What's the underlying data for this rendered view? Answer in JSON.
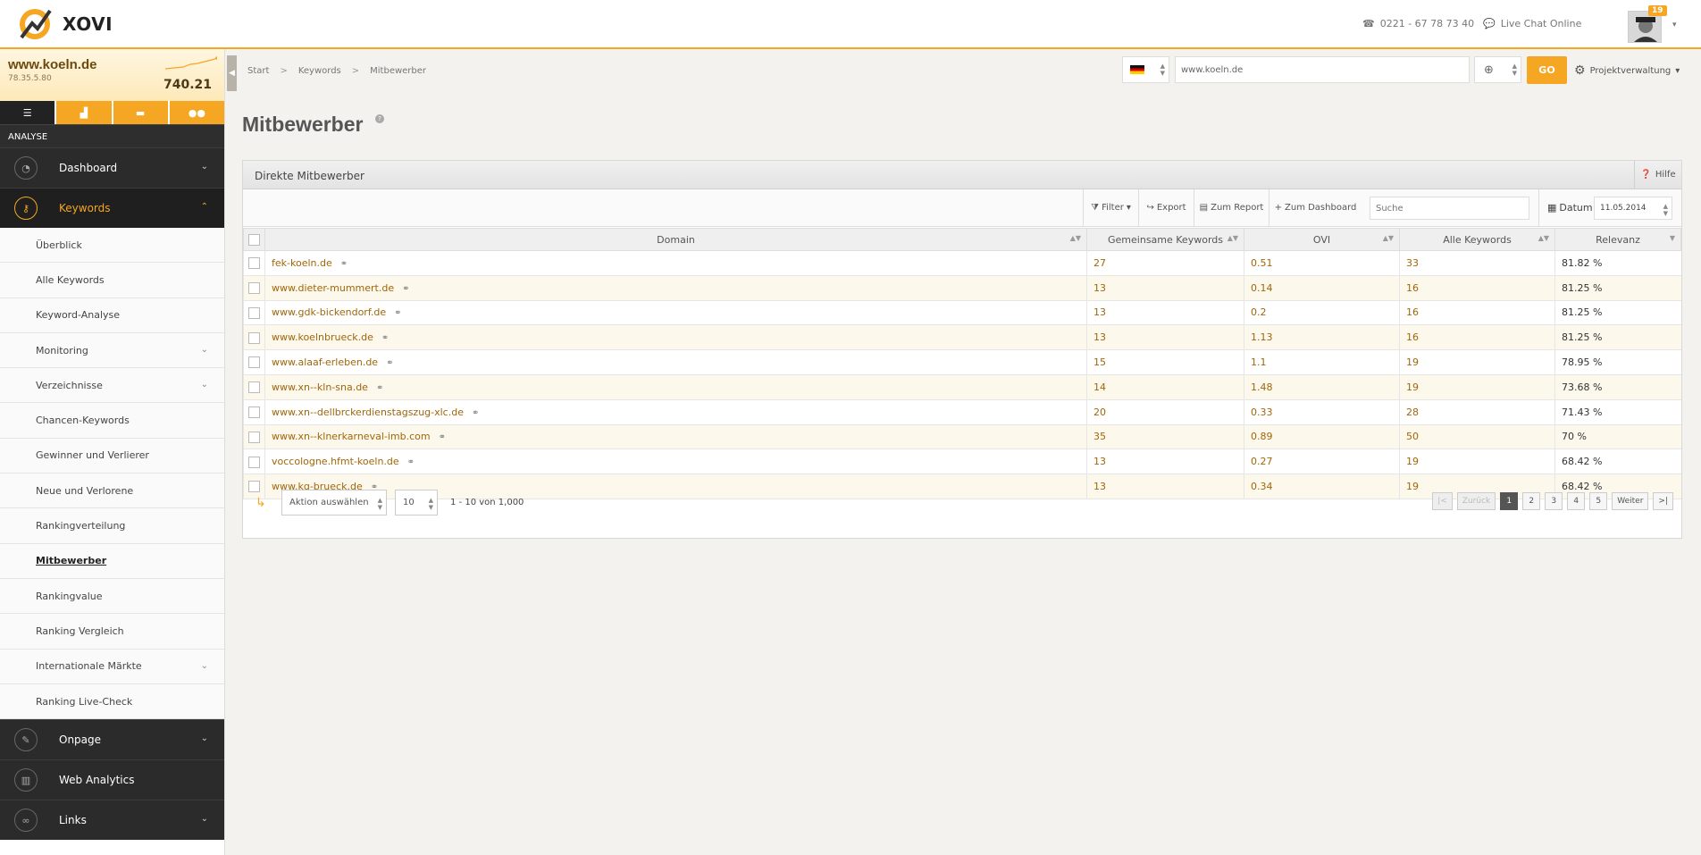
{
  "header": {
    "logo_text": "XOVI",
    "phone": "0221 - 67 78 73 40",
    "chat": "Live Chat Online",
    "notification_count": "19"
  },
  "project": {
    "domain": "www.koeln.de",
    "ip": "78.35.5.80",
    "value": "740.21"
  },
  "sidebar": {
    "section_label": "ANALYSE",
    "main_items": [
      {
        "label": "Dashboard"
      },
      {
        "label": "Keywords"
      },
      {
        "label": "Onpage"
      },
      {
        "label": "Web Analytics"
      },
      {
        "label": "Links"
      }
    ],
    "sub_items": [
      {
        "label": "Überblick"
      },
      {
        "label": "Alle Keywords"
      },
      {
        "label": "Keyword-Analyse"
      },
      {
        "label": "Monitoring"
      },
      {
        "label": "Verzeichnisse"
      },
      {
        "label": "Chancen-Keywords"
      },
      {
        "label": "Gewinner und Verlierer"
      },
      {
        "label": "Neue und Verlorene"
      },
      {
        "label": "Rankingverteilung"
      },
      {
        "label": "Mitbewerber"
      },
      {
        "label": "Rankingvalue"
      },
      {
        "label": "Ranking Vergleich"
      },
      {
        "label": "Internationale Märkte"
      },
      {
        "label": "Ranking Live-Check"
      }
    ]
  },
  "breadcrumb": [
    "Start",
    "Keywords",
    "Mitbewerber"
  ],
  "domain_field": {
    "value": "www.koeln.de"
  },
  "go_label": "GO",
  "project_menu_label": "Projektverwaltung",
  "page_title": "Mitbewerber",
  "panel": {
    "title": "Direkte Mitbewerber",
    "help_label": "Hilfe",
    "toolbar": {
      "filter": "Filter",
      "export": "Export",
      "report": "Zum Report",
      "dashboard": "Zum Dashboard",
      "search_placeholder": "Suche",
      "date_label": "Datum",
      "date_value": "11.05.2014"
    },
    "columns": [
      "Domain",
      "Gemeinsame Keywords",
      "OVI",
      "Alle Keywords",
      "Relevanz"
    ],
    "rows": [
      {
        "domain": "fek-koeln.de",
        "common": "27",
        "ovi": "0.51",
        "all": "33",
        "relevance": "81.82 %"
      },
      {
        "domain": "www.dieter-mummert.de",
        "common": "13",
        "ovi": "0.14",
        "all": "16",
        "relevance": "81.25 %"
      },
      {
        "domain": "www.gdk-bickendorf.de",
        "common": "13",
        "ovi": "0.2",
        "all": "16",
        "relevance": "81.25 %"
      },
      {
        "domain": "www.koelnbrueck.de",
        "common": "13",
        "ovi": "1.13",
        "all": "16",
        "relevance": "81.25 %"
      },
      {
        "domain": "www.alaaf-erleben.de",
        "common": "15",
        "ovi": "1.1",
        "all": "19",
        "relevance": "78.95 %"
      },
      {
        "domain": "www.xn--kln-sna.de",
        "common": "14",
        "ovi": "1.48",
        "all": "19",
        "relevance": "73.68 %"
      },
      {
        "domain": "www.xn--dellbrckerdienstagszug-xlc.de",
        "common": "20",
        "ovi": "0.33",
        "all": "28",
        "relevance": "71.43 %"
      },
      {
        "domain": "www.xn--klnerkarneval-imb.com",
        "common": "35",
        "ovi": "0.89",
        "all": "50",
        "relevance": "70 %"
      },
      {
        "domain": "voccologne.hfmt-koeln.de",
        "common": "13",
        "ovi": "0.27",
        "all": "19",
        "relevance": "68.42 %"
      },
      {
        "domain": "www.kg-brueck.de",
        "common": "13",
        "ovi": "0.34",
        "all": "19",
        "relevance": "68.42 %"
      }
    ],
    "footer": {
      "action_label": "Aktion auswählen",
      "per_page": "10",
      "range": "1 - 10 von 1,000",
      "first": "|<",
      "prev": "Zurück",
      "pages": [
        "1",
        "2",
        "3",
        "4",
        "5"
      ],
      "next": "Weiter",
      "last": ">|"
    }
  },
  "colors": {
    "accent": "#f5a623",
    "sidebar_dark": "#2b2b2b",
    "link": "#a0660a"
  }
}
